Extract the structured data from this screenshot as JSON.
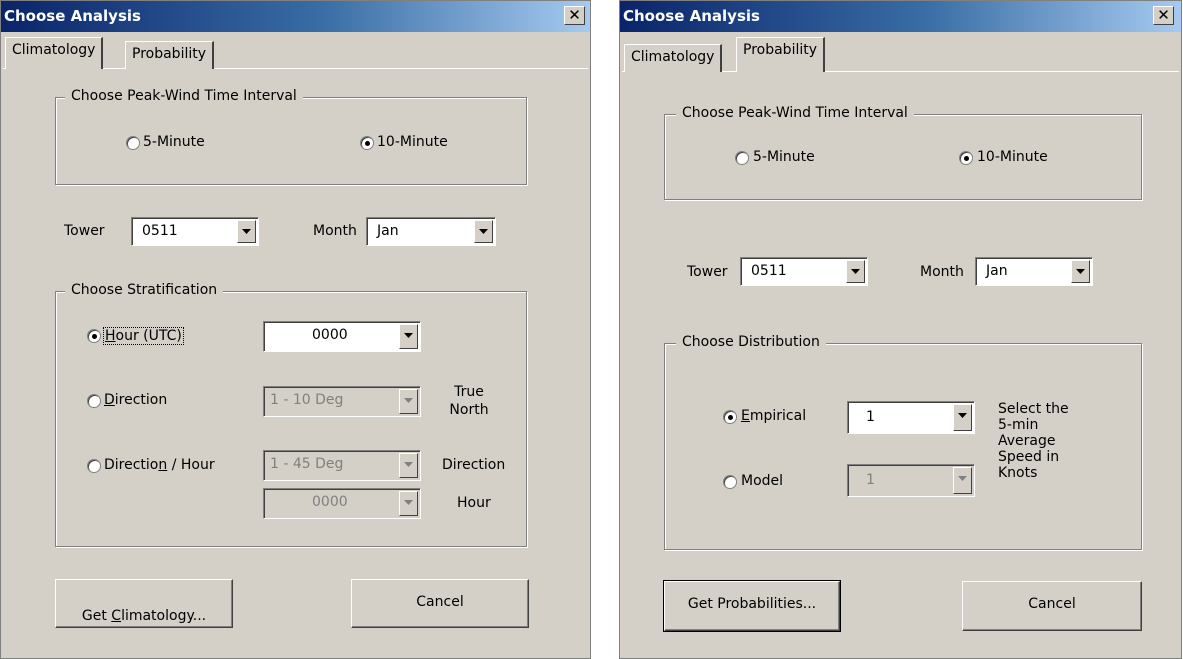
{
  "left_dialog": {
    "title": "Choose Analysis",
    "close_glyph": "✕",
    "tabs": [
      {
        "label": "Climatology",
        "active": true
      },
      {
        "label": "Probability",
        "active": false
      }
    ],
    "peak_wind_group": {
      "legend": "Choose Peak-Wind Time Interval",
      "options": [
        {
          "label": "5-Minute",
          "selected": false
        },
        {
          "label": "10-Minute",
          "selected": true
        }
      ]
    },
    "tower_label": "Tower",
    "tower_value": "0511",
    "month_label": "Month",
    "month_value": "Jan",
    "stratification_group": {
      "legend": "Choose Stratification",
      "hour": {
        "label_before": "",
        "label_u": "H",
        "label_after": "our (UTC)",
        "selected": true,
        "combo_value": "0000"
      },
      "direction": {
        "label_u": "D",
        "label_after": "irection",
        "selected": false,
        "combo_value": "1 - 10 Deg",
        "note_line1": "True",
        "note_line2": "North"
      },
      "direction_hour": {
        "label_before": "Directio",
        "label_u": "n",
        "label_after": " / Hour",
        "selected": false,
        "combo1_value": "1 - 45 Deg",
        "combo2_value": "0000",
        "note1": "Direction",
        "note2": "Hour"
      }
    },
    "primary_button": {
      "before": "Get ",
      "u": "C",
      "after": "limatology..."
    },
    "cancel_label": "Cancel"
  },
  "right_dialog": {
    "title": "Choose Analysis",
    "close_glyph": "✕",
    "tabs": [
      {
        "label": "Climatology",
        "active": false
      },
      {
        "label": "Probability",
        "active": true
      }
    ],
    "peak_wind_group": {
      "legend": "Choose Peak-Wind Time Interval",
      "options": [
        {
          "label": "5-Minute",
          "selected": false
        },
        {
          "label": "10-Minute",
          "selected": true
        }
      ]
    },
    "tower_label": "Tower",
    "tower_value": "0511",
    "month_label": "Month",
    "month_value": "Jan",
    "distribution_group": {
      "legend": "Choose Distribution",
      "empirical": {
        "label_u": "E",
        "label_after": "mpirical",
        "selected": true,
        "combo_value": "1"
      },
      "model": {
        "label": "Model",
        "selected": false,
        "combo_value": "1"
      },
      "note_lines": [
        "Select the",
        "5-min",
        "Average",
        "Speed in",
        "Knots"
      ]
    },
    "primary_label": "Get Probabilities...",
    "cancel_label": "Cancel"
  }
}
